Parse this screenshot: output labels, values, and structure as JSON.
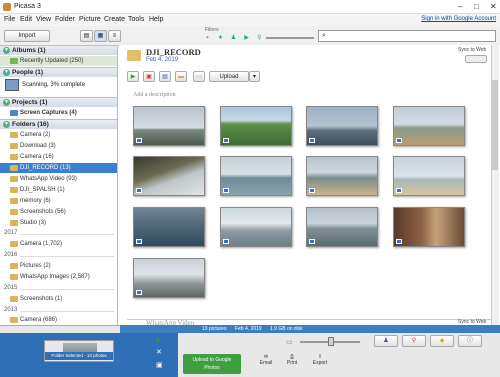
{
  "window": {
    "title": "Picasa 3"
  },
  "menu": [
    "File",
    "Edit",
    "View",
    "Folder",
    "Picture",
    "Create",
    "Tools",
    "Help"
  ],
  "signin": "Sign in with Google Account",
  "toolbar": {
    "import": "Import",
    "filters_label": "Filters"
  },
  "sidebar": {
    "albums_header": "Albums (1)",
    "album_item": "Recently Updated (250)",
    "people_header": "People (1)",
    "people_status": "Scanning, 3% complete",
    "projects_header": "Projects (1)",
    "projects_item": "Screen Captures (4)",
    "folders_header": "Folders (16)",
    "folders": [
      "Camera (2)",
      "Download (3)",
      "Camera (16)",
      "DJI_RECORD (13)",
      "WhatsApp Video (93)",
      "DJI_SPALSH (1)",
      "memory (6)",
      "Screenshots (56)",
      "Studio (3)"
    ],
    "year_2017": "2017",
    "y2017_items": [
      "Camera (1,702)"
    ],
    "year_2016": "2016",
    "y2016_items": [
      "Pictures (2)",
      "WhatsApp Images (2,587)"
    ],
    "year_2015": "2015",
    "y2015_items": [
      "Screenshots (1)"
    ],
    "year_2013": "2013",
    "y2013_items": [
      "Camera (686)"
    ]
  },
  "folder": {
    "title": "DJI_RECORD",
    "date": "Feb 4, 2019",
    "sync_label": "Sync to Web",
    "upload": "Upload",
    "description_placeholder": "Add a description",
    "next_folder": "WhatsApp Video"
  },
  "status": {
    "count": "13 pictures",
    "date": "Feb 4, 2019",
    "size": "1.9 GB on disk"
  },
  "bottom": {
    "selection": "Folder Selected - 13 photos",
    "upload_line1": "Upload to Google",
    "upload_line2": "Photos",
    "email": "Email",
    "print": "Print",
    "export": "Export"
  }
}
